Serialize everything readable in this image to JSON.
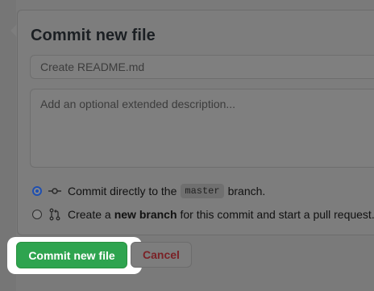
{
  "form": {
    "title": "Commit new file",
    "summary_placeholder": "Create README.md",
    "description_placeholder": "Add an optional extended description..."
  },
  "options": {
    "direct": {
      "before": "Commit directly to the",
      "branch": "master",
      "after": "branch.",
      "checked": true,
      "icon": "git-commit-icon"
    },
    "new_branch": {
      "before": "Create a",
      "bold": "new branch",
      "after": "for this commit and start a pull request.",
      "checked": false,
      "icon": "git-pull-request-icon"
    }
  },
  "buttons": {
    "commit_label": "Commit new file",
    "cancel_label": "Cancel"
  },
  "colors": {
    "commit_button": "#2ea44f",
    "cancel_text": "#7a2126",
    "radio_selected": "#1f4fb0",
    "highlight": "#ffffff"
  }
}
